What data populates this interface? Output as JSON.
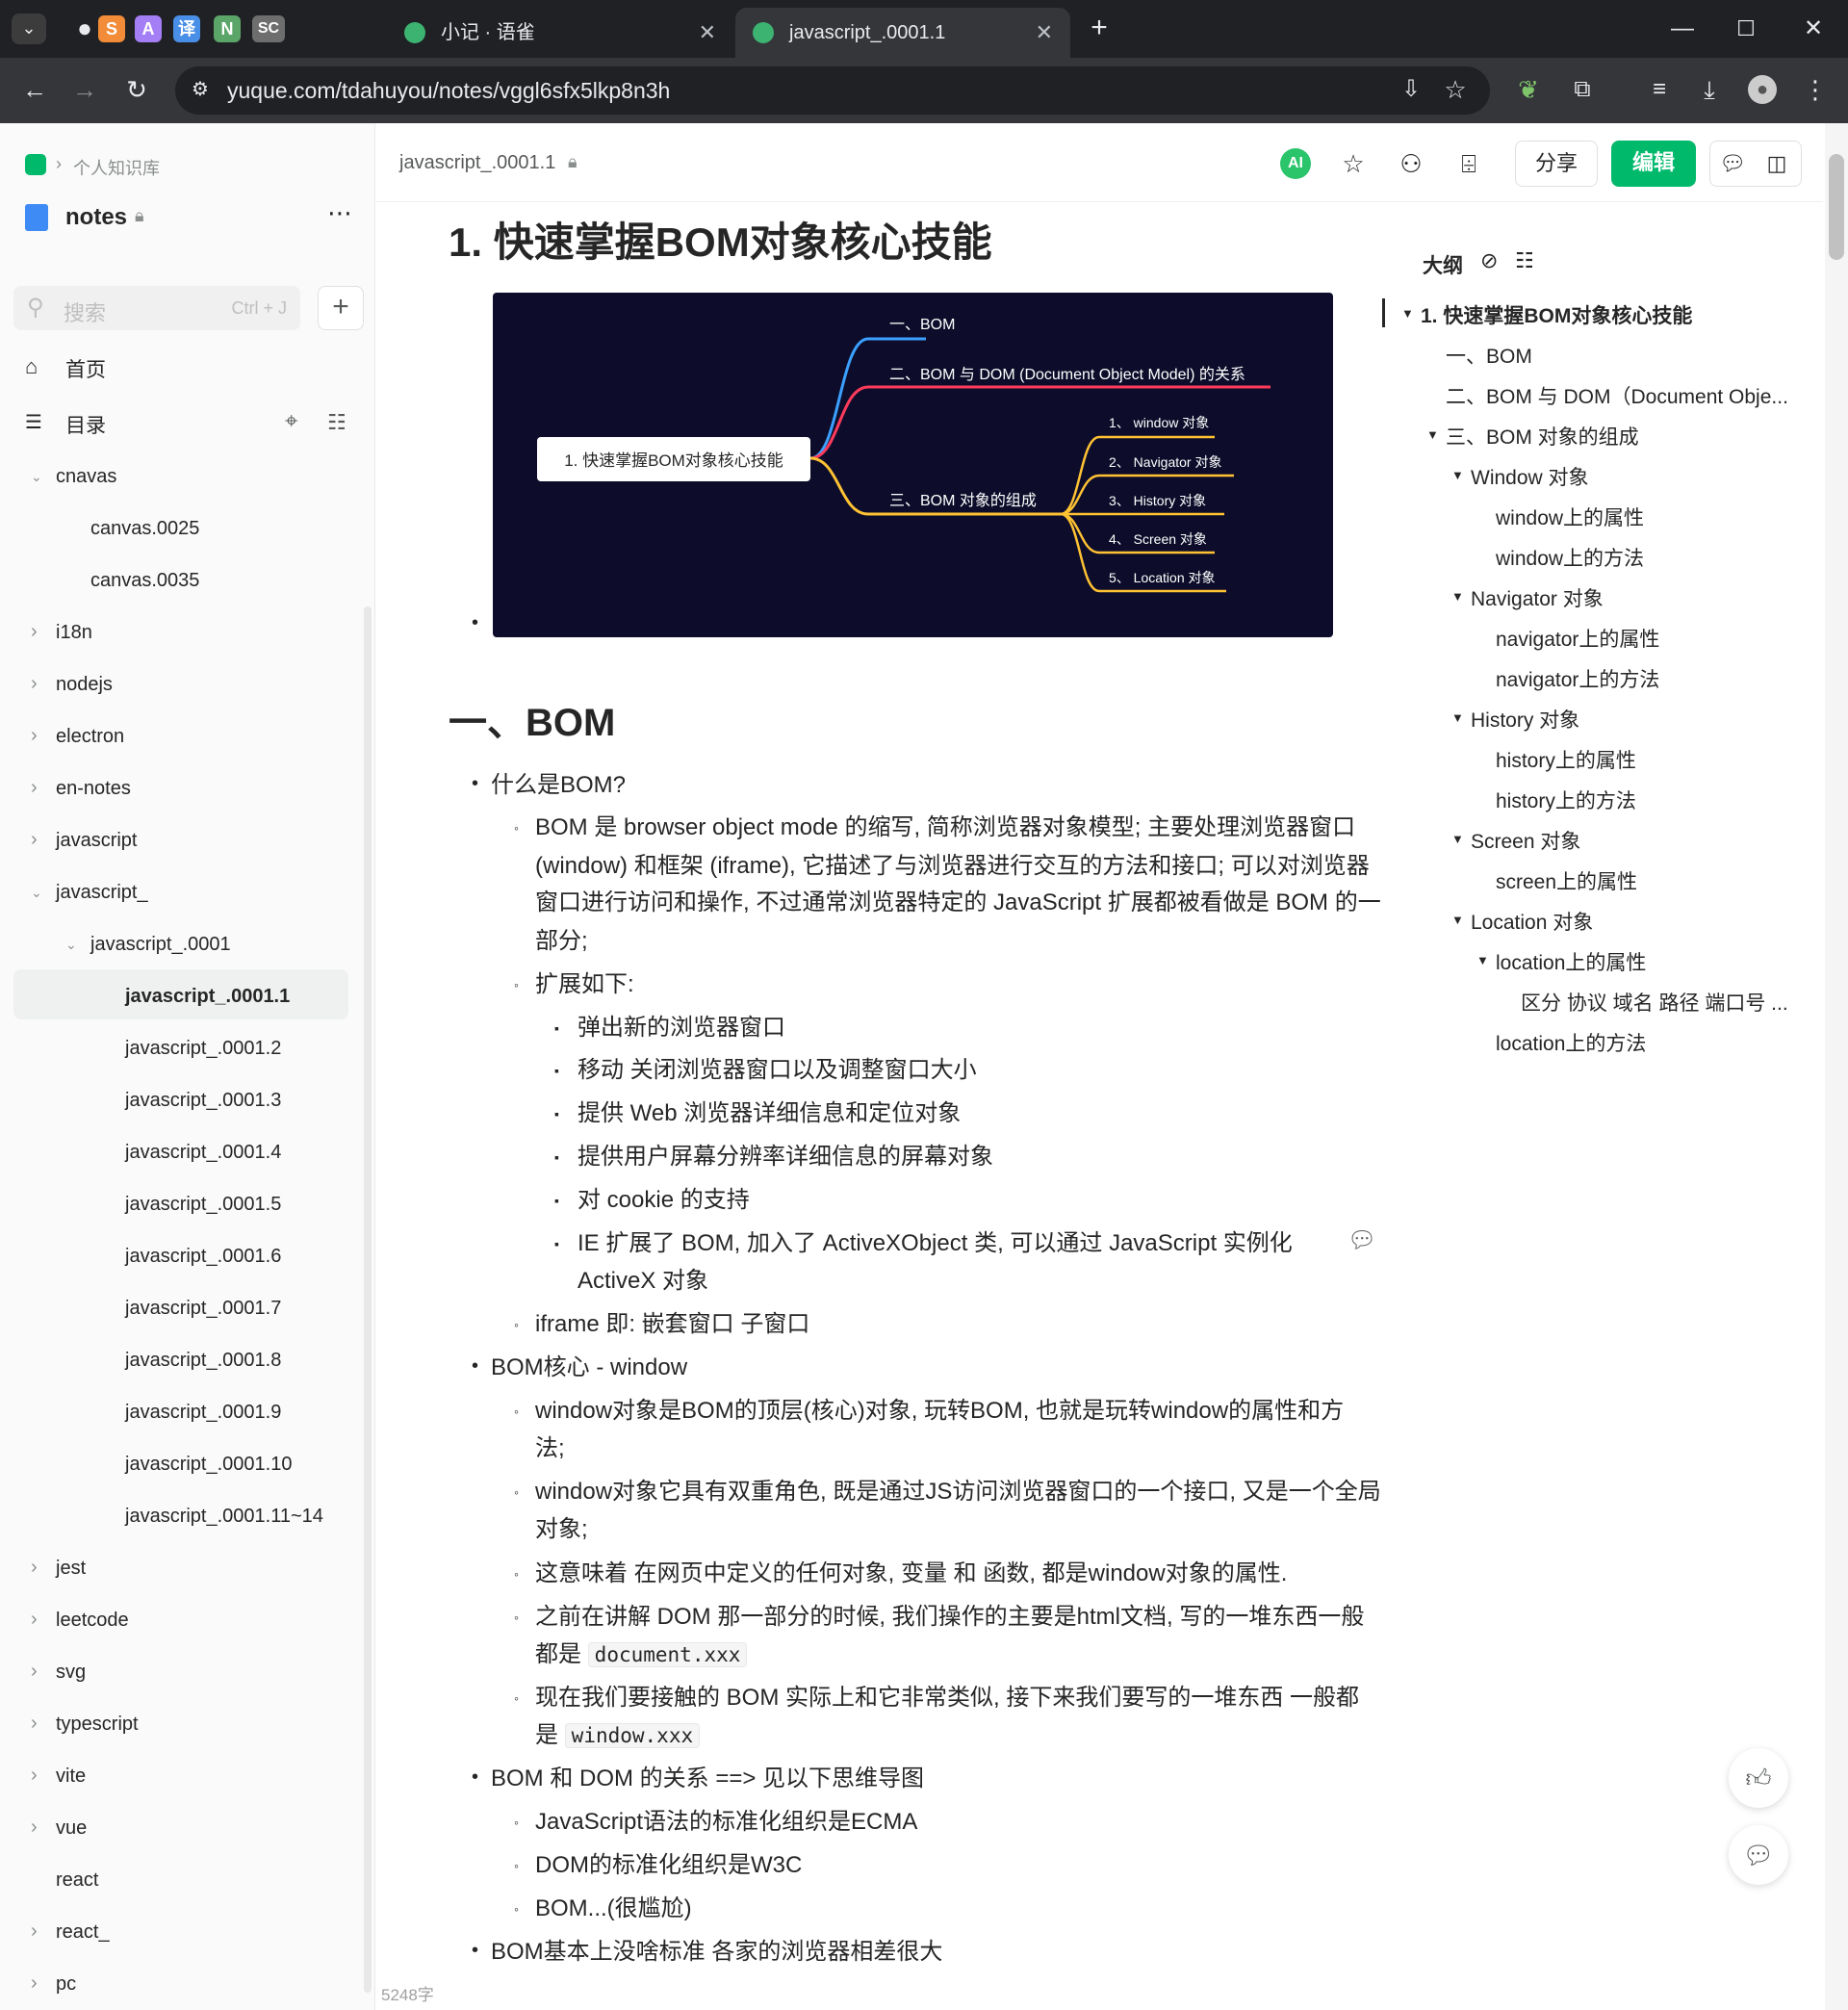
{
  "browser": {
    "tab_icons": [
      {
        "label": "S",
        "color": "#f28c38"
      },
      {
        "label": "A",
        "color": "#a37ef5"
      },
      {
        "label": "译",
        "color": "#4a8fe7"
      },
      {
        "label": "N",
        "color": "#5aa567"
      },
      {
        "label": "SC",
        "color": "#6e6e6e"
      }
    ],
    "tabs": [
      {
        "title": "小记 · 语雀"
      },
      {
        "title": "javascript_.0001.1"
      }
    ],
    "url": "yuque.com/tdahuyou/notes/vggl6sfx5lkp8n3h"
  },
  "sidebar": {
    "breadcrumb": "个人知识库",
    "book_title": "notes",
    "search_placeholder": "搜索",
    "search_shortcut": "Ctrl + J",
    "nav": {
      "home": "首页",
      "catalog": "目录"
    },
    "tree": [
      {
        "label": "cnavas",
        "level": 0,
        "caret": "down"
      },
      {
        "label": "canvas.0025",
        "level": 1,
        "caret": ""
      },
      {
        "label": "canvas.0035",
        "level": 1,
        "caret": ""
      },
      {
        "label": "i18n",
        "level": 0,
        "caret": "right"
      },
      {
        "label": "nodejs",
        "level": 0,
        "caret": "right"
      },
      {
        "label": "electron",
        "level": 0,
        "caret": "right"
      },
      {
        "label": "en-notes",
        "level": 0,
        "caret": "right"
      },
      {
        "label": "javascript",
        "level": 0,
        "caret": "right"
      },
      {
        "label": "javascript_",
        "level": 0,
        "caret": "down"
      },
      {
        "label": "javascript_.0001",
        "level": 1,
        "caret": "down"
      },
      {
        "label": "javascript_.0001.1",
        "level": 2,
        "caret": "",
        "active": true
      },
      {
        "label": "javascript_.0001.2",
        "level": 2,
        "caret": ""
      },
      {
        "label": "javascript_.0001.3",
        "level": 2,
        "caret": ""
      },
      {
        "label": "javascript_.0001.4",
        "level": 2,
        "caret": ""
      },
      {
        "label": "javascript_.0001.5",
        "level": 2,
        "caret": ""
      },
      {
        "label": "javascript_.0001.6",
        "level": 2,
        "caret": ""
      },
      {
        "label": "javascript_.0001.7",
        "level": 2,
        "caret": ""
      },
      {
        "label": "javascript_.0001.8",
        "level": 2,
        "caret": ""
      },
      {
        "label": "javascript_.0001.9",
        "level": 2,
        "caret": ""
      },
      {
        "label": "javascript_.0001.10",
        "level": 2,
        "caret": ""
      },
      {
        "label": "javascript_.0001.11~14",
        "level": 2,
        "caret": ""
      },
      {
        "label": "jest",
        "level": 0,
        "caret": "right"
      },
      {
        "label": "leetcode",
        "level": 0,
        "caret": "right"
      },
      {
        "label": "svg",
        "level": 0,
        "caret": "right"
      },
      {
        "label": "typescript",
        "level": 0,
        "caret": "right"
      },
      {
        "label": "vite",
        "level": 0,
        "caret": "right"
      },
      {
        "label": "vue",
        "level": 0,
        "caret": "right"
      },
      {
        "label": "react",
        "level": 0,
        "caret": ""
      },
      {
        "label": "react_",
        "level": 0,
        "caret": "right"
      },
      {
        "label": "pc",
        "level": 0,
        "caret": "right"
      }
    ],
    "word_count": "5248字"
  },
  "header": {
    "doc_title": "javascript_.0001.1",
    "ai_label": "AI",
    "share_label": "分享",
    "edit_label": "编辑"
  },
  "content": {
    "h1": "1. 快速掌握BOM对象核心技能",
    "mindmap": {
      "root": "1. 快速掌握BOM对象核心技能",
      "b1": "一、BOM",
      "b2": "二、BOM 与 DOM (Document Object Model) 的关系",
      "b3": "三、BOM 对象的组成",
      "leaves": [
        "1、 window 对象",
        "2、 Navigator 对象",
        "3、 History 对象",
        "4、 Screen 对象",
        "5、 Location 对象"
      ]
    },
    "h2": "一、BOM",
    "what_is": "什么是BOM?",
    "def_lines": [
      "BOM 是 browser object mode 的缩写, 简称浏览器对象模型; 主要处理浏览器窗口",
      "(window) 和框架 (iframe), 它描述了与浏览器进行交互的方法和接口; 可以对浏览器",
      "窗口进行访问和操作, 不过通常浏览器特定的 JavaScript 扩展都被看做是 BOM 的一",
      "部分;"
    ],
    "ext_title": "扩展如下:",
    "ext_items": [
      "弹出新的浏览器窗口",
      "移动 关闭浏览器窗口以及调整窗口大小",
      "提供 Web 浏览器详细信息和定位对象",
      "提供用户屏幕分辨率详细信息的屏幕对象",
      "对 cookie 的支持"
    ],
    "ie_line1": "IE 扩展了 BOM, 加入了 ActiveXObject 类, 可以通过 JavaScript 实例化",
    "ie_line2": "ActiveX 对象",
    "iframe_line": "iframe 即: 嵌套窗口 子窗口",
    "core_title": "BOM核心 - window",
    "core1_l1": "window对象是BOM的顶层(核心)对象, 玩转BOM, 也就是玩转window的属性和方",
    "core1_l2": "法;",
    "core2_l1": "window对象它具有双重角色, 既是通过JS访问浏览器窗口的一个接口, 又是一个全局",
    "core2_l2": "对象;",
    "core3": "这意味着 在网页中定义的任何对象, 变量 和 函数, 都是window对象的属性.",
    "core4_l1": "之前在讲解 DOM 那一部分的时候, 我们操作的主要是html文档, 写的一堆东西一般",
    "core4_l2": "都是",
    "core4_code": "document.xxx",
    "core5_l1": "现在我们要接触的 BOM 实际上和它非常类似, 接下来我们要写的一堆东西 一般都",
    "core5_l2": "是",
    "core5_code": "window.xxx",
    "rel_title": "BOM 和 DOM 的关系 ==> 见以下思维导图",
    "rel1": "JavaScript语法的标准化组织是ECMA",
    "rel2": "DOM的标准化组织是W3C",
    "rel3": "BOM...(很尴尬)",
    "last": "BOM基本上没啥标准 各家的浏览器相差很大"
  },
  "outline": {
    "title": "大纲",
    "items": [
      {
        "label": "1. 快速掌握BOM对象核心技能",
        "caret": true,
        "bold": true
      },
      {
        "label": "一、BOM",
        "caret": false
      },
      {
        "label": "二、BOM 与 DOM（Document Obje...",
        "caret": false
      },
      {
        "label": "三、BOM 对象的组成",
        "caret": true
      },
      {
        "label": "Window 对象",
        "caret": true
      },
      {
        "label": "window上的属性",
        "caret": false
      },
      {
        "label": "window上的方法",
        "caret": false
      },
      {
        "label": "Navigator 对象",
        "caret": true
      },
      {
        "label": "navigator上的属性",
        "caret": false
      },
      {
        "label": "navigator上的方法",
        "caret": false
      },
      {
        "label": "History 对象",
        "caret": true
      },
      {
        "label": "history上的属性",
        "caret": false
      },
      {
        "label": "history上的方法",
        "caret": false
      },
      {
        "label": "Screen 对象",
        "caret": true
      },
      {
        "label": "screen上的属性",
        "caret": false
      },
      {
        "label": "Location 对象",
        "caret": true
      },
      {
        "label": "location上的属性",
        "caret": true
      },
      {
        "label": "区分 协议 域名 路径 端口号 ...",
        "caret": false
      },
      {
        "label": "location上的方法",
        "caret": false
      }
    ]
  },
  "colors": {
    "brand_green": "#00b96b",
    "mind_bg": "#0d0d2b",
    "mind_blue": "#3ba0ff",
    "mind_red": "#ff3b5c",
    "mind_yellow": "#ffc233"
  }
}
